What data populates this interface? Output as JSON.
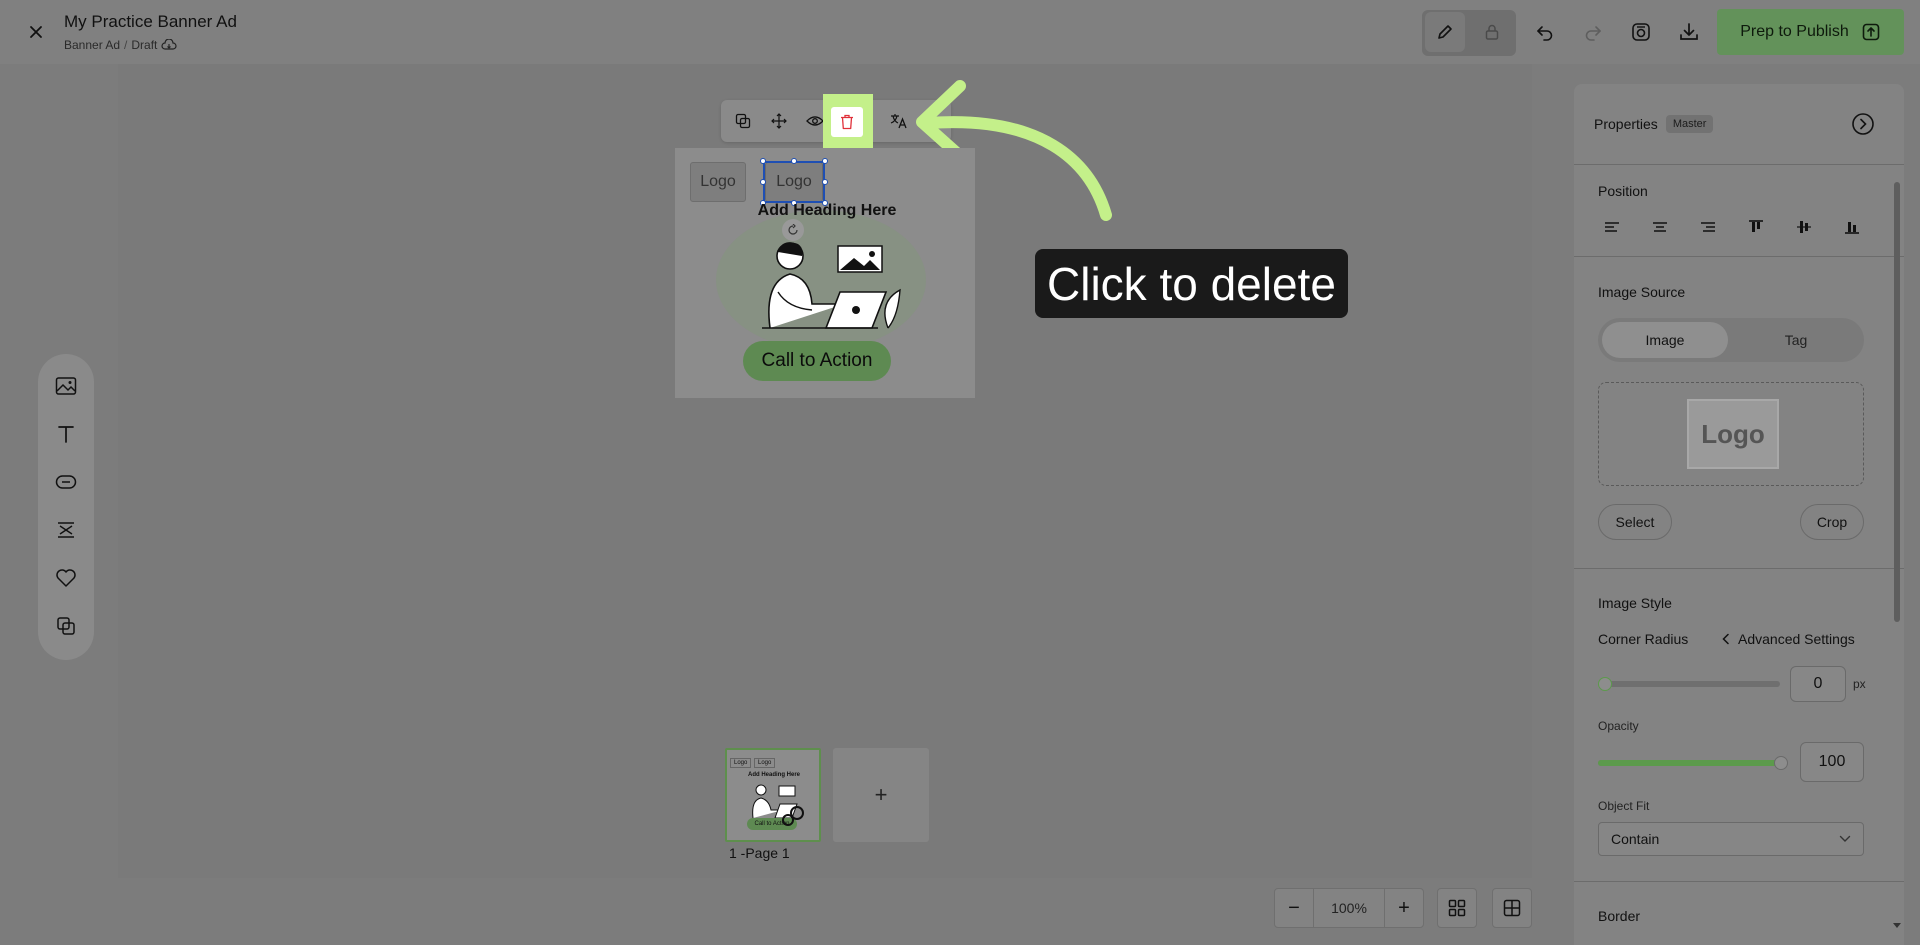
{
  "header": {
    "title": "My Practice Banner Ad",
    "breadcrumb": [
      "Banner Ad",
      "/",
      "Draft"
    ],
    "publish_label": "Prep to Publish"
  },
  "element_toolbar": {
    "icons": [
      "duplicate-icon",
      "move-icon",
      "eye-icon",
      "trash-icon",
      "translate-icon"
    ]
  },
  "banner": {
    "logo_left": "Logo",
    "logo_selected": "Logo",
    "heading": "Add Heading Here",
    "cta": "Call to Action"
  },
  "tooltip": {
    "text": "Click to delete"
  },
  "pages": {
    "page_label": "1 -Page 1",
    "thumb_logo_a": "Logo",
    "thumb_logo_b": "Logo",
    "thumb_heading": "Add Heading Here",
    "thumb_cta": "Call to Action",
    "add_symbol": "+"
  },
  "zoom": {
    "minus": "−",
    "value": "100%",
    "plus": "+"
  },
  "properties": {
    "title": "Properties",
    "badge": "Master",
    "position_title": "Position",
    "image_source_title": "Image Source",
    "tab_image": "Image",
    "tab_tag": "Tag",
    "preview_logo": "Logo",
    "select_label": "Select",
    "crop_label": "Crop",
    "image_style_title": "Image Style",
    "corner_radius_label": "Corner Radius",
    "advanced_label": "Advanced Settings",
    "corner_radius_value": "0",
    "corner_radius_unit": "px",
    "opacity_label": "Opacity",
    "opacity_value": "100",
    "opacity_fraction": 1.0,
    "object_fit_label": "Object Fit",
    "object_fit_value": "Contain",
    "border_title": "Border"
  },
  "colors": {
    "publish_bg": "#63925a",
    "highlight": "#c4f08a",
    "tooltip_bg": "#1a1a1a",
    "delete_icon": "#e0303a",
    "selection": "#1f4fb3"
  }
}
